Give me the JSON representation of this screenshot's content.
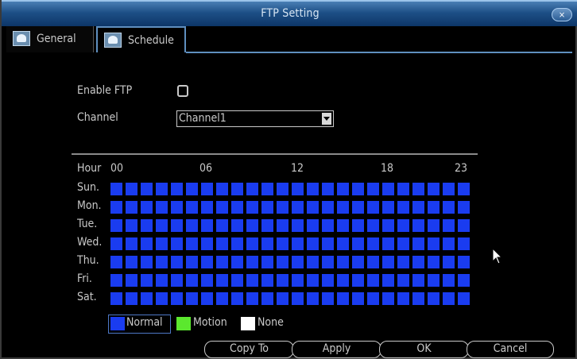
{
  "window": {
    "title": "FTP Setting",
    "close_label": "×"
  },
  "tabs": [
    {
      "label": "General",
      "icon": "settings-icon"
    },
    {
      "label": "Schedule",
      "icon": "settings-icon",
      "active": true
    }
  ],
  "form": {
    "enable_ftp_label": "Enable FTP",
    "enable_ftp_checked": false,
    "channel_label": "Channel",
    "channel_value": "Channel1"
  },
  "schedule": {
    "hour_heading": "Hour",
    "hour_ticks": [
      "00",
      "06",
      "12",
      "18",
      "23"
    ],
    "days": [
      "Sun.",
      "Mon.",
      "Tue.",
      "Wed.",
      "Thu.",
      "Fri.",
      "Sat."
    ],
    "hours_per_day": 24,
    "fill_mode": "Normal"
  },
  "legend": [
    {
      "label": "Normal",
      "color": "#1a3cf0",
      "selected": true
    },
    {
      "label": "Motion",
      "color": "#5be82e"
    },
    {
      "label": "None",
      "color": "#ffffff"
    }
  ],
  "buttons": {
    "copy_to": "Copy To",
    "apply": "Apply",
    "ok": "OK",
    "cancel": "Cancel"
  }
}
